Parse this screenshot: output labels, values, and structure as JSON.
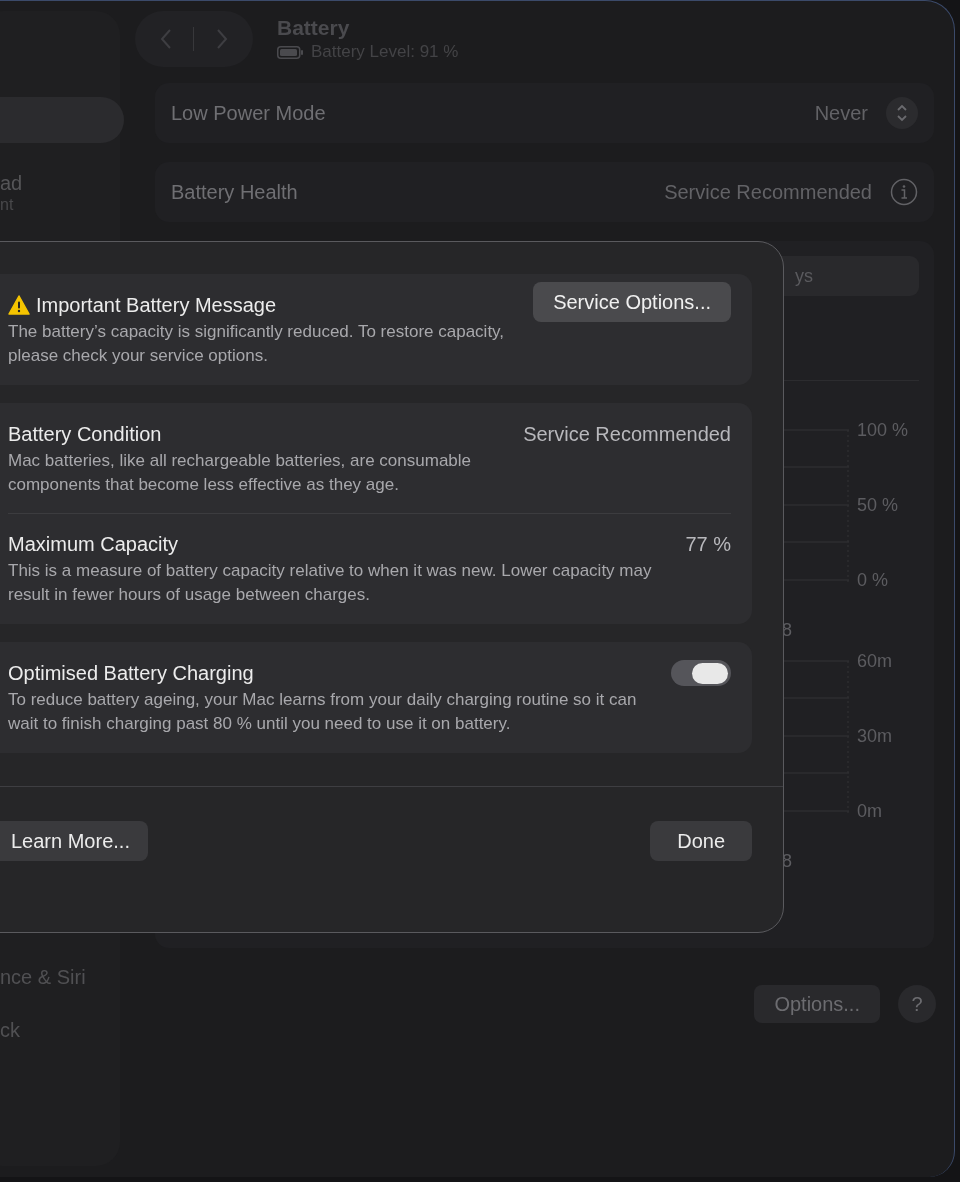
{
  "sidebar": {
    "items": [
      {
        "selected": true
      },
      {
        "selected": false,
        "label": "ad",
        "sublabel": "nt"
      },
      {
        "selected": false,
        "label": "nce & Siri"
      },
      {
        "selected": false,
        "label": "ck"
      }
    ]
  },
  "header": {
    "title": "Battery",
    "subtitle": "Battery Level: 91 %"
  },
  "settings": [
    {
      "kind": "popup",
      "label": "Low Power Mode",
      "value": "Never"
    },
    {
      "kind": "info",
      "label": "Battery Health",
      "value": "Service Recommended"
    }
  ],
  "usage_panel": {
    "tab_fragment": "ys",
    "level_axis": [
      "100 %",
      "50 %",
      "0 %"
    ],
    "level_axis_edge": "8",
    "time_axis": [
      "60m",
      "30m",
      "0m"
    ],
    "time_axis_edge": "8"
  },
  "footer_buttons": [
    "Options...",
    "?"
  ],
  "sheet": {
    "groups": [
      {
        "rows": [
          {
            "kind": "message",
            "title": "Important Battery Message",
            "description": "The battery’s capacity is significantly reduced. To restore capacity, please check your service options.",
            "button": "Service Options..."
          }
        ]
      },
      {
        "rows": [
          {
            "kind": "value",
            "title": "Battery Condition",
            "description": "Mac batteries, like all rechargeable batteries, are consumable components that become less effective as they age.",
            "value": "Service Recommended"
          },
          {
            "kind": "value",
            "title": "Maximum Capacity",
            "description": "This is a measure of battery capacity relative to when it was new. Lower capacity may result in fewer hours of usage between charges.",
            "value": "77 %"
          }
        ]
      },
      {
        "rows": [
          {
            "kind": "toggle",
            "title": "Optimised Battery Charging",
            "description": "To reduce battery ageing, your Mac learns from your daily charging routine so it can wait to finish charging past 80 % until you need to use it on battery.",
            "on": true
          }
        ]
      }
    ],
    "buttons": [
      "Learn More...",
      "Done"
    ]
  }
}
